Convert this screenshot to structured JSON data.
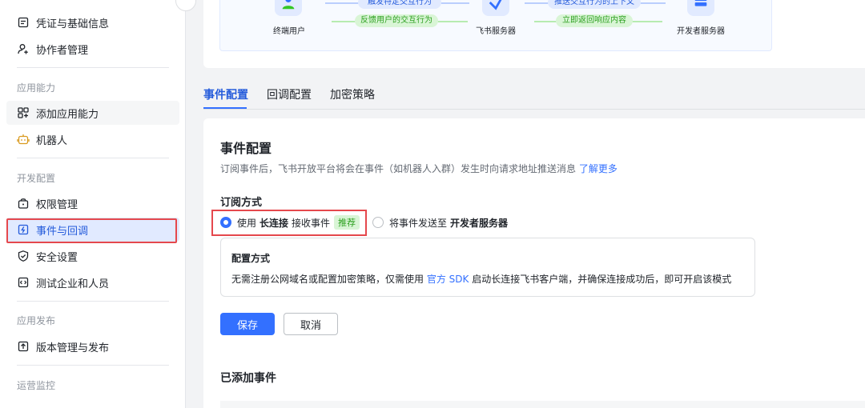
{
  "sidebar": {
    "items": [
      {
        "label": "凭证与基础信息",
        "icon": "credential-icon"
      },
      {
        "label": "协作者管理",
        "icon": "add-user-icon"
      },
      {
        "label": "添加应用能力",
        "icon": "add-app-icon"
      },
      {
        "label": "机器人",
        "icon": "robot-icon"
      },
      {
        "label": "权限管理",
        "icon": "lock-icon"
      },
      {
        "label": "事件与回调",
        "icon": "event-icon"
      },
      {
        "label": "安全设置",
        "icon": "shield-icon"
      },
      {
        "label": "测试企业和人员",
        "icon": "code-icon"
      },
      {
        "label": "版本管理与发布",
        "icon": "upload-icon"
      }
    ],
    "groups": {
      "app_ability": "应用能力",
      "dev_config": "开发配置",
      "app_publish": "应用发布",
      "ops_monitor": "运营监控"
    }
  },
  "flow": {
    "end_user": "终端用户",
    "feishu_server": "飞书服务器",
    "dev_server": "开发者服务器",
    "trigger": "触发特定交互行为",
    "feedback": "反馈用户的交互行为",
    "push_context": "推送交互行为的上下文",
    "respond": "立即返回响应内容"
  },
  "tabs": [
    "事件配置",
    "回调配置",
    "加密策略"
  ],
  "event_config": {
    "title": "事件配置",
    "desc": "订阅事件后，飞书开放平台将会在事件（如机器人入群）发生时向请求地址推送消息",
    "learn_more": "了解更多",
    "subscribe_title": "订阅方式",
    "option1_prefix": "使用",
    "option1_bold": "长连接",
    "option1_suffix": "接收事件",
    "option1_badge": "推荐",
    "option2_prefix": "将事件发送至",
    "option2_bold": "开发者服务器",
    "config_title": "配置方式",
    "config_desc_prefix": "无需注册公网域名或配置加密策略，仅需使用",
    "config_link": "官方 SDK",
    "config_desc_suffix": "启动长连接飞书客户端，并确保连接成功后，即可开启该模式",
    "save": "保存",
    "cancel": "取消",
    "added_title": "已添加事件"
  },
  "colors": {
    "accent": "#3370ff",
    "highlight": "#e5484d",
    "success": "#2ea121"
  }
}
